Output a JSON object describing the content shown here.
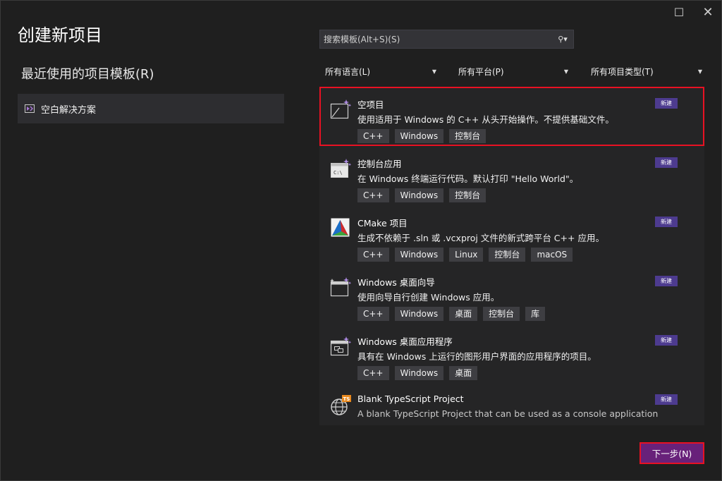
{
  "window": {
    "title": "创建新项目",
    "maximize_glyph": "☐",
    "close_glyph": "✕"
  },
  "recent": {
    "heading": "最近使用的项目模板(R)",
    "items": [
      {
        "label": "空白解决方案",
        "icon": "solution-icon"
      }
    ]
  },
  "search": {
    "placeholder": "搜索模板(Alt+S)(S)",
    "value": "",
    "button_glyph": "⚲▾"
  },
  "filters": [
    {
      "label": "所有语言(L)"
    },
    {
      "label": "所有平台(P)"
    },
    {
      "label": "所有项目类型(T)"
    }
  ],
  "templates": [
    {
      "name": "空项目",
      "desc": "使用适用于 Windows 的 C++ 从头开始操作。不提供基础文件。",
      "tags": [
        "C++",
        "Windows",
        "控制台"
      ],
      "badge": "新建",
      "icon": "empty-project-icon",
      "selected": true
    },
    {
      "name": "控制台应用",
      "desc": "在 Windows 终端运行代码。默认打印 \"Hello World\"。",
      "tags": [
        "C++",
        "Windows",
        "控制台"
      ],
      "badge": "新建",
      "icon": "console-app-icon"
    },
    {
      "name": "CMake 项目",
      "desc": "生成不依赖于 .sln 或 .vcxproj 文件的新式跨平台 C++ 应用。",
      "tags": [
        "C++",
        "Windows",
        "Linux",
        "控制台",
        "macOS"
      ],
      "badge": "新建",
      "icon": "cmake-icon"
    },
    {
      "name": "Windows 桌面向导",
      "desc": "使用向导自行创建 Windows 应用。",
      "tags": [
        "C++",
        "Windows",
        "桌面",
        "控制台",
        "库"
      ],
      "badge": "新建",
      "icon": "desktop-wizard-icon"
    },
    {
      "name": "Windows 桌面应用程序",
      "desc": "具有在 Windows 上运行的图形用户界面的应用程序的项目。",
      "tags": [
        "C++",
        "Windows",
        "桌面"
      ],
      "badge": "新建",
      "icon": "desktop-app-icon"
    },
    {
      "name": "Blank TypeScript Project",
      "desc": "A blank TypeScript Project that can be used as a console application",
      "tags": [],
      "badge": "新建",
      "icon": "typescript-project-icon"
    }
  ],
  "footer": {
    "next_label": "下一步(N)"
  },
  "colors": {
    "background": "#1f1f1f",
    "list_bg": "#252526",
    "badge": "#4d3b8f",
    "primary_button": "#68217a",
    "highlight_border": "#e81123"
  }
}
